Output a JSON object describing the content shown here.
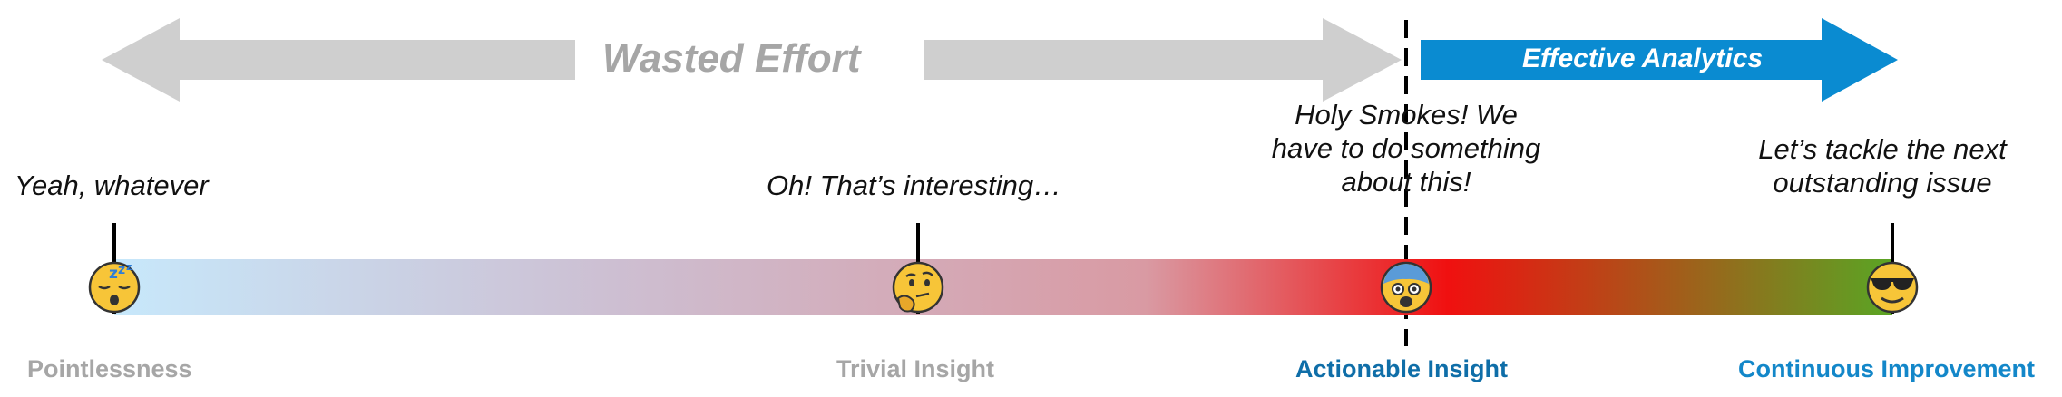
{
  "banner": {
    "wasted": {
      "label": "Wasted Effort",
      "color": "#cfcfcf",
      "text_color": "#a6a6a6"
    },
    "effective": {
      "label": "Effective Analytics",
      "color": "#0a8bd1",
      "text_color": "#ffffff"
    }
  },
  "gradient": {
    "stops": [
      "#c7e8fb",
      "#cdbfd2",
      "#d99aa3",
      "#f01010",
      "#5aa524"
    ]
  },
  "stages": [
    {
      "quote": [
        "Yeah, whatever"
      ],
      "emoji": "😴",
      "icon": "sleeping-face-icon",
      "label": "Pointlessness",
      "label_color": "#a6a6a6"
    },
    {
      "quote": [
        "Oh! That’s interesting…"
      ],
      "emoji": "🤔",
      "icon": "thinking-face-icon",
      "label": "Trivial Insight",
      "label_color": "#a6a6a6"
    },
    {
      "quote": [
        "Holy Smokes! We",
        "have to do something",
        "about this!"
      ],
      "emoji": "😨",
      "icon": "fearful-face-icon",
      "label": "Actionable Insight",
      "label_color": "#0f6ea8"
    },
    {
      "quote": [
        "Let’s tackle the next",
        "outstanding issue"
      ],
      "emoji": "😎",
      "icon": "sunglasses-face-icon",
      "label": "Continuous Improvement",
      "label_color": "#1387c9"
    }
  ]
}
